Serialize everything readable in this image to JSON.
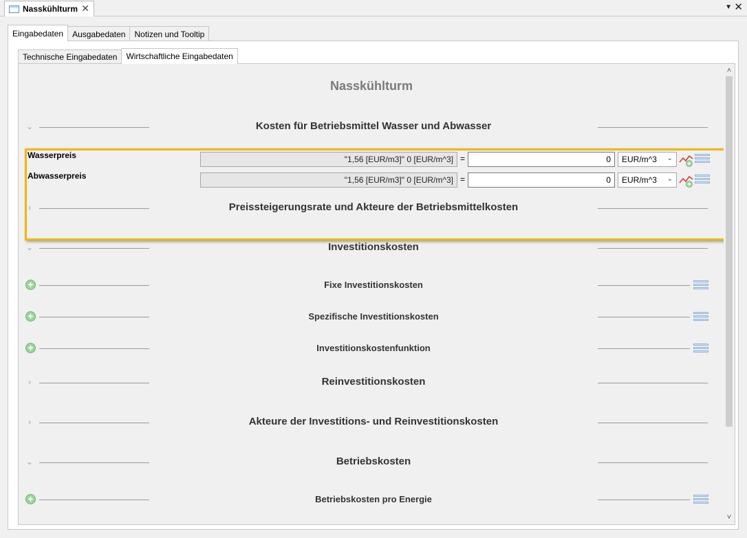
{
  "editor_tab": {
    "title": "Nasskühlturm",
    "close": "✕"
  },
  "view_controls": {
    "menu": "▼",
    "close": "✕"
  },
  "tabs_level1": [
    "Eingabedaten",
    "Ausgabedaten",
    "Notizen und Tooltip"
  ],
  "tabs_level2": [
    "Technische Eingabedaten",
    "Wirtschaftliche Eingabedaten"
  ],
  "main_title": "Nasskühlturm",
  "sections": {
    "water_costs": "Kosten für Betriebsmittel Wasser und Abwasser",
    "price_increase": "Preissteigerungsrate und Akteure der Betriebsmittelkosten",
    "investment": "Investitionskosten",
    "fixed_investment": "Fixe Investitionskosten",
    "specific_investment": "Spezifische Investitionskosten",
    "investment_function": "Investitionskostenfunktion",
    "reinvestment": "Reinvestitionskosten",
    "actors_investment": "Akteure der Investitions- und Reinvestitionskosten",
    "operating": "Betriebskosten",
    "operating_per_energy": "Betriebskosten pro Energie"
  },
  "params": [
    {
      "name": "Wasserpreis",
      "formula": "\"1,56 [EUR/m3]\" 0 [EUR/m^3]",
      "equals": "=",
      "value": "0",
      "unit": "EUR/m^3"
    },
    {
      "name": "Abwasserpreis",
      "formula": "\"1,56 [EUR/m3]\" 0 [EUR/m^3]",
      "equals": "=",
      "value": "0",
      "unit": "EUR/m^3"
    }
  ],
  "icons": {
    "expanded": "chevron-down-icon",
    "collapsed": "chevron-right-icon",
    "add": "plus-circle-icon",
    "menu": "hamburger-menu-icon",
    "trend": "trend-chart-icon",
    "dropdown": "dropdown-arrow-icon"
  },
  "colors": {
    "highlight": "#f0b800",
    "title_gray": "#7a7a7a",
    "add_green": "#9ed39e"
  }
}
